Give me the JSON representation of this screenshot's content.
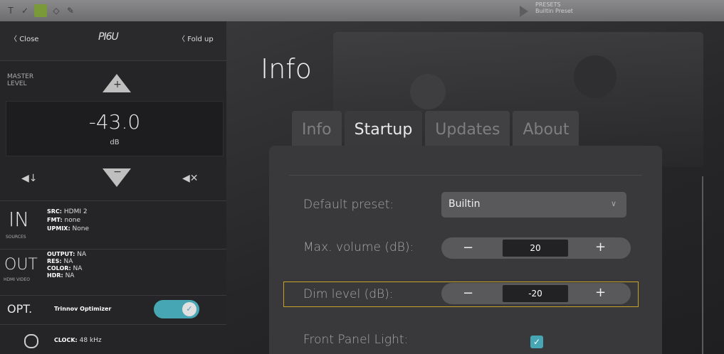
{
  "toolbar": {
    "icons": [
      "text-icon",
      "check-icon",
      "comment-icon",
      "shape-icon",
      "pen-icon"
    ],
    "presets_label": "PRESETS",
    "presets_value": "Builtin Preset"
  },
  "header": {
    "close_label": "Close",
    "foldup_label": "Fold up",
    "logo_text": "PI6U"
  },
  "master": {
    "label": "MASTER LEVEL",
    "value": "-43.0",
    "unit": "dB",
    "up_symbol": "+",
    "down_symbol": "−"
  },
  "input": {
    "label": "IN",
    "sublabel": "SOURCES",
    "src_key": "SRC:",
    "src": "HDMI 2",
    "fmt_key": "FMT:",
    "fmt": "none",
    "upmix_key": "UPMIX:",
    "upmix": "None"
  },
  "output": {
    "label": "OUT",
    "sublabel": "HDMI VIDEO",
    "output_key": "OUTPUT:",
    "output": "NA",
    "res_key": "RES:",
    "res": "NA",
    "color_key": "COLOR:",
    "color": "NA",
    "hdr_key": "HDR:",
    "hdr": "NA"
  },
  "optimizer": {
    "label": "OPT.",
    "name": "Trinnov Optimizer",
    "enabled": true
  },
  "clock": {
    "key": "CLOCK:",
    "value": "48 kHz"
  },
  "main": {
    "title": "Info",
    "tabs": [
      {
        "label": "Info",
        "active": false
      },
      {
        "label": "Startup",
        "active": true
      },
      {
        "label": "Updates",
        "active": false
      },
      {
        "label": "About",
        "active": false
      }
    ],
    "settings": {
      "default_preset_label": "Default preset:",
      "default_preset_value": "Builtin",
      "max_volume_label": "Max. volume (dB):",
      "max_volume_value": "20",
      "dim_level_label": "Dim level (dB):",
      "dim_level_value": "-20",
      "front_panel_label": "Front Panel Light:",
      "front_panel_checked": true
    }
  },
  "colors": {
    "accent": "#46a6b3",
    "highlight": "#c8a02c",
    "panel": "#39393b"
  }
}
